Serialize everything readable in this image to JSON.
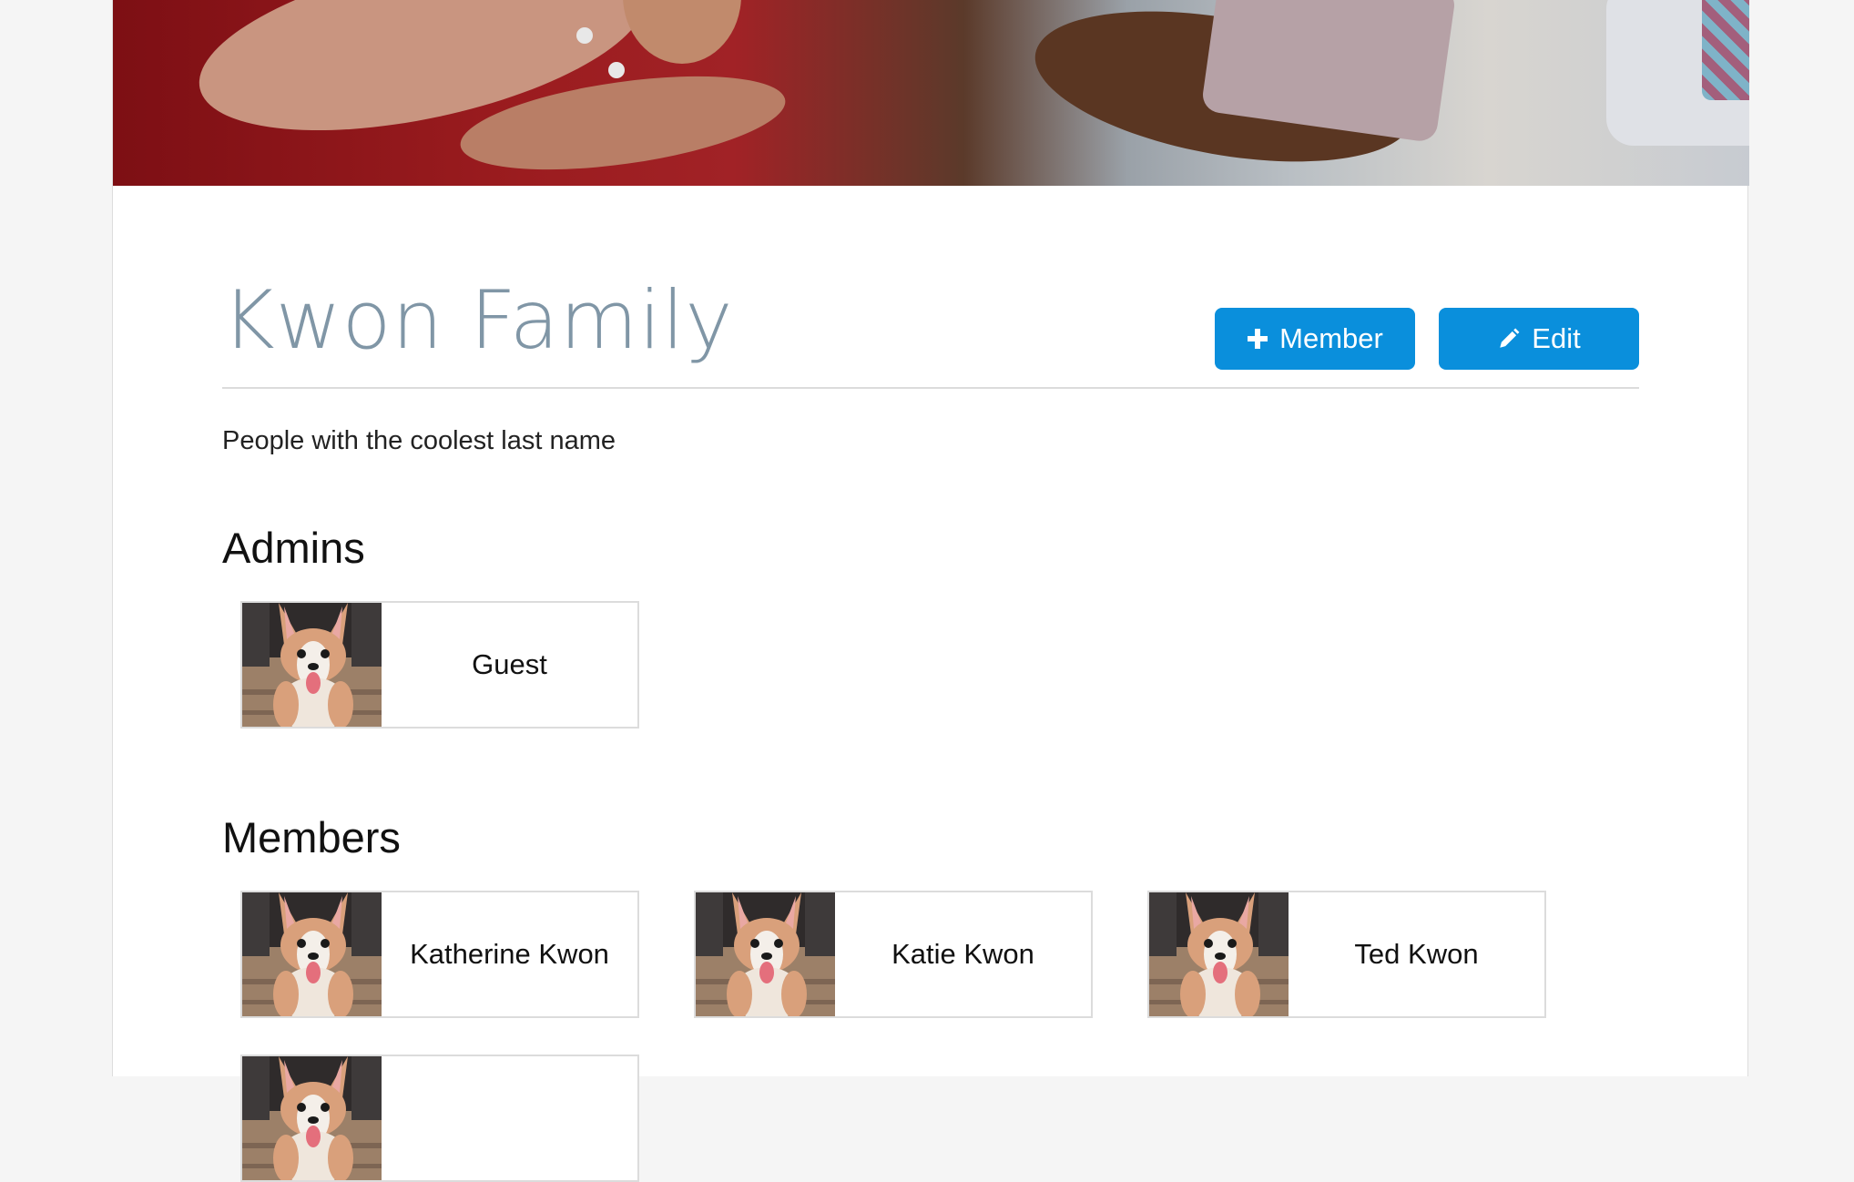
{
  "group": {
    "title": "Kwon Family",
    "description": "People with the coolest last name"
  },
  "actions": {
    "add_member_label": "Member",
    "edit_label": "Edit",
    "add_icon": "plus-icon",
    "edit_icon": "pencil-icon"
  },
  "sections": {
    "admins_heading": "Admins",
    "members_heading": "Members"
  },
  "admins": [
    {
      "name": "Guest",
      "avatar": "corgi-puppy"
    }
  ],
  "members": [
    {
      "name": "Katherine Kwon",
      "avatar": "corgi-puppy"
    },
    {
      "name": "Katie Kwon",
      "avatar": "corgi-puppy"
    },
    {
      "name": "Ted Kwon",
      "avatar": "corgi-puppy"
    },
    {
      "name": "",
      "avatar": "corgi-puppy"
    }
  ],
  "colors": {
    "accent": "#0a8fdc",
    "title": "#8096a6"
  }
}
